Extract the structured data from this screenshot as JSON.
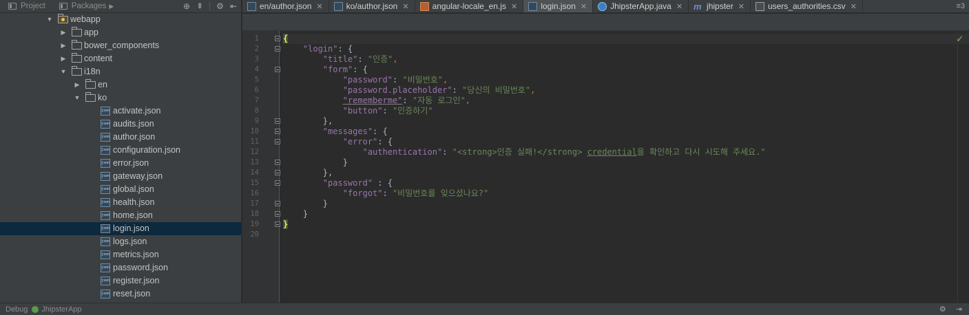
{
  "left_toolbar": {
    "tabs": [
      "Project",
      "Packages"
    ]
  },
  "tree": [
    {
      "label": "webapp",
      "kind": "folder-web",
      "expanded": true,
      "depth": 0,
      "selected": false
    },
    {
      "label": "app",
      "kind": "folder",
      "expanded": false,
      "depth": 1,
      "selected": false
    },
    {
      "label": "bower_components",
      "kind": "folder",
      "expanded": false,
      "depth": 1,
      "selected": false
    },
    {
      "label": "content",
      "kind": "folder",
      "expanded": false,
      "depth": 1,
      "selected": false
    },
    {
      "label": "i18n",
      "kind": "folder",
      "expanded": true,
      "depth": 1,
      "selected": false
    },
    {
      "label": "en",
      "kind": "folder",
      "expanded": false,
      "depth": 2,
      "selected": false
    },
    {
      "label": "ko",
      "kind": "folder",
      "expanded": true,
      "depth": 2,
      "selected": false
    },
    {
      "label": "activate.json",
      "kind": "json",
      "depth": 3,
      "selected": false
    },
    {
      "label": "audits.json",
      "kind": "json",
      "depth": 3,
      "selected": false
    },
    {
      "label": "author.json",
      "kind": "json",
      "depth": 3,
      "selected": false
    },
    {
      "label": "configuration.json",
      "kind": "json",
      "depth": 3,
      "selected": false
    },
    {
      "label": "error.json",
      "kind": "json",
      "depth": 3,
      "selected": false
    },
    {
      "label": "gateway.json",
      "kind": "json",
      "depth": 3,
      "selected": false
    },
    {
      "label": "global.json",
      "kind": "json",
      "depth": 3,
      "selected": false
    },
    {
      "label": "health.json",
      "kind": "json",
      "depth": 3,
      "selected": false
    },
    {
      "label": "home.json",
      "kind": "json",
      "depth": 3,
      "selected": false
    },
    {
      "label": "login.json",
      "kind": "json",
      "depth": 3,
      "selected": true
    },
    {
      "label": "logs.json",
      "kind": "json",
      "depth": 3,
      "selected": false
    },
    {
      "label": "metrics.json",
      "kind": "json",
      "depth": 3,
      "selected": false
    },
    {
      "label": "password.json",
      "kind": "json",
      "depth": 3,
      "selected": false
    },
    {
      "label": "register.json",
      "kind": "json",
      "depth": 3,
      "selected": false
    },
    {
      "label": "reset.json",
      "kind": "json",
      "depth": 3,
      "selected": false
    }
  ],
  "editor_tabs": [
    {
      "label": "en/author.json",
      "icon": "json",
      "active": false
    },
    {
      "label": "ko/author.json",
      "icon": "json",
      "active": false
    },
    {
      "label": "angular-locale_en.js",
      "icon": "js",
      "active": false
    },
    {
      "label": "login.json",
      "icon": "json",
      "active": true
    },
    {
      "label": "JhipsterApp.java",
      "icon": "java",
      "active": false
    },
    {
      "label": "jhipster",
      "icon": "mvn",
      "active": false
    },
    {
      "label": "users_authorities.csv",
      "icon": "csv",
      "active": false
    }
  ],
  "tabs_overflow": "≡3",
  "line_numbers": [
    "1",
    "2",
    "3",
    "4",
    "5",
    "6",
    "7",
    "8",
    "9",
    "10",
    "11",
    "12",
    "13",
    "14",
    "15",
    "16",
    "17",
    "18",
    "19",
    "20"
  ],
  "code_lines": [
    [
      {
        "t": "{",
        "c": "brace-hl"
      }
    ],
    [
      {
        "t": "    "
      },
      {
        "t": "\"login\"",
        "c": "k"
      },
      {
        "t": ": {"
      }
    ],
    [
      {
        "t": "        "
      },
      {
        "t": "\"title\"",
        "c": "k"
      },
      {
        "t": ": "
      },
      {
        "t": "\"인증\"",
        "c": "s"
      },
      {
        "t": ",",
        "c": "p"
      }
    ],
    [
      {
        "t": "        "
      },
      {
        "t": "\"form\"",
        "c": "k"
      },
      {
        "t": ": {"
      }
    ],
    [
      {
        "t": "            "
      },
      {
        "t": "\"password\"",
        "c": "k"
      },
      {
        "t": ": "
      },
      {
        "t": "\"비밀번호\"",
        "c": "s"
      },
      {
        "t": ",",
        "c": "p"
      }
    ],
    [
      {
        "t": "            "
      },
      {
        "t": "\"password.placeholder\"",
        "c": "k"
      },
      {
        "t": ": "
      },
      {
        "t": "\"당신의 비밀번호\"",
        "c": "s"
      },
      {
        "t": ",",
        "c": "p"
      }
    ],
    [
      {
        "t": "            "
      },
      {
        "t": "\"rememberme\"",
        "c": "k uline"
      },
      {
        "t": ": "
      },
      {
        "t": "\"자동 로그인\"",
        "c": "s"
      },
      {
        "t": ",",
        "c": "p"
      }
    ],
    [
      {
        "t": "            "
      },
      {
        "t": "\"button\"",
        "c": "k"
      },
      {
        "t": ": "
      },
      {
        "t": "\"인증하기\"",
        "c": "s"
      }
    ],
    [
      {
        "t": "        },"
      }
    ],
    [
      {
        "t": "        "
      },
      {
        "t": "\"messages\"",
        "c": "k"
      },
      {
        "t": ": {"
      }
    ],
    [
      {
        "t": "            "
      },
      {
        "t": "\"error\"",
        "c": "k"
      },
      {
        "t": ": {"
      }
    ],
    [
      {
        "t": "                "
      },
      {
        "t": "\"authentication\"",
        "c": "k"
      },
      {
        "t": ": "
      },
      {
        "t": "\"<strong>인증 실패!</strong> ",
        "c": "s"
      },
      {
        "t": "credential",
        "c": "s uline"
      },
      {
        "t": "을 확인하고 다시 시도해 주세요.\"",
        "c": "s"
      }
    ],
    [
      {
        "t": "            }"
      }
    ],
    [
      {
        "t": "        },"
      }
    ],
    [
      {
        "t": "        "
      },
      {
        "t": "\"password\"",
        "c": "k"
      },
      {
        "t": " : {"
      }
    ],
    [
      {
        "t": "            "
      },
      {
        "t": "\"forgot\"",
        "c": "k"
      },
      {
        "t": ": "
      },
      {
        "t": "\"비밀번호를 잊으셨나요?\"",
        "c": "s"
      }
    ],
    [
      {
        "t": "        }"
      }
    ],
    [
      {
        "t": "    }"
      }
    ],
    [
      {
        "t": "}",
        "c": "brace-hl"
      }
    ],
    [
      {
        "t": ""
      }
    ]
  ],
  "fold_markers": [
    1,
    2,
    4,
    9,
    10,
    11,
    13,
    14,
    15,
    17,
    18,
    19
  ],
  "status": {
    "left": "Debug",
    "run_config": "JhipsterApp"
  },
  "colors": {
    "background": "#2b2b2b",
    "panel": "#3c3f41",
    "json_key": "#9876aa",
    "json_string": "#6a8759",
    "selection": "#0d293e"
  }
}
